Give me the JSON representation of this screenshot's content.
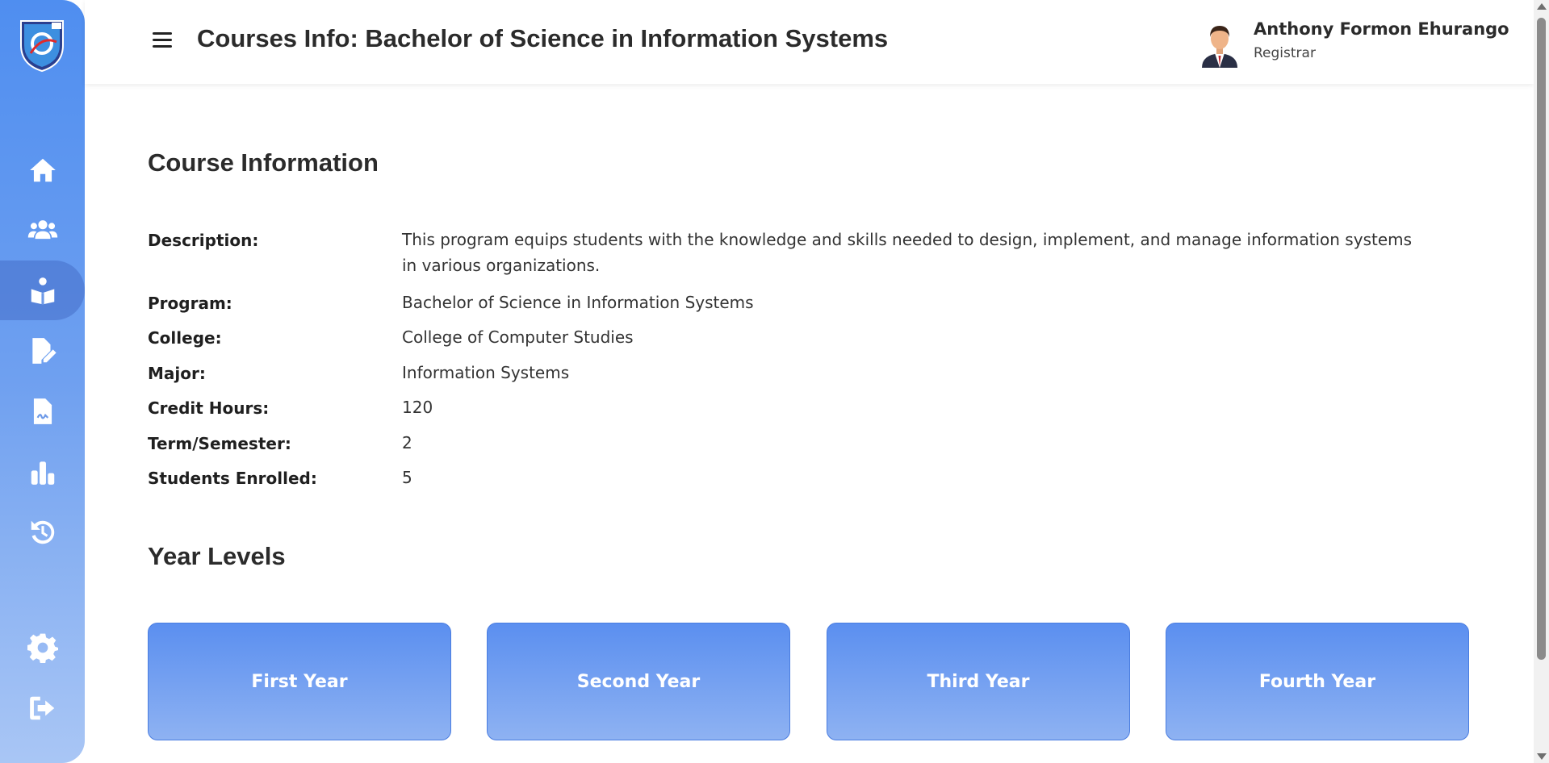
{
  "header": {
    "title": "Courses Info: Bachelor of Science in Information Systems",
    "user_name": "Anthony Formon Ehurango",
    "user_role": "Registrar"
  },
  "sidebar": {
    "items": [
      {
        "icon": "home-icon"
      },
      {
        "icon": "users-icon"
      },
      {
        "icon": "reading-icon",
        "active": true
      },
      {
        "icon": "file-edit-icon"
      },
      {
        "icon": "file-signature-icon"
      },
      {
        "icon": "bar-chart-icon"
      },
      {
        "icon": "history-icon"
      },
      {
        "icon": "gear-icon"
      },
      {
        "icon": "logout-icon"
      }
    ]
  },
  "course_info": {
    "heading": "Course Information",
    "fields": [
      {
        "label": "Description:",
        "value": "This program equips students with the knowledge and skills needed to design, implement, and manage information systems in various organizations."
      },
      {
        "label": "Program:",
        "value": "Bachelor of Science in Information Systems"
      },
      {
        "label": "College:",
        "value": "College of Computer Studies"
      },
      {
        "label": "Major:",
        "value": "Information Systems"
      },
      {
        "label": "Credit Hours:",
        "value": "120"
      },
      {
        "label": "Term/Semester:",
        "value": "2"
      },
      {
        "label": "Students Enrolled:",
        "value": "5"
      }
    ]
  },
  "year_levels": {
    "heading": "Year Levels",
    "cards": [
      {
        "label": "First Year"
      },
      {
        "label": "Second Year"
      },
      {
        "label": "Third Year"
      },
      {
        "label": "Fourth Year"
      }
    ]
  },
  "colors": {
    "sidebar_top": "#4f8ef0",
    "sidebar_bottom": "#a9c6f5",
    "card_top": "#5b8ff0",
    "card_bottom": "#8eb2f2"
  }
}
